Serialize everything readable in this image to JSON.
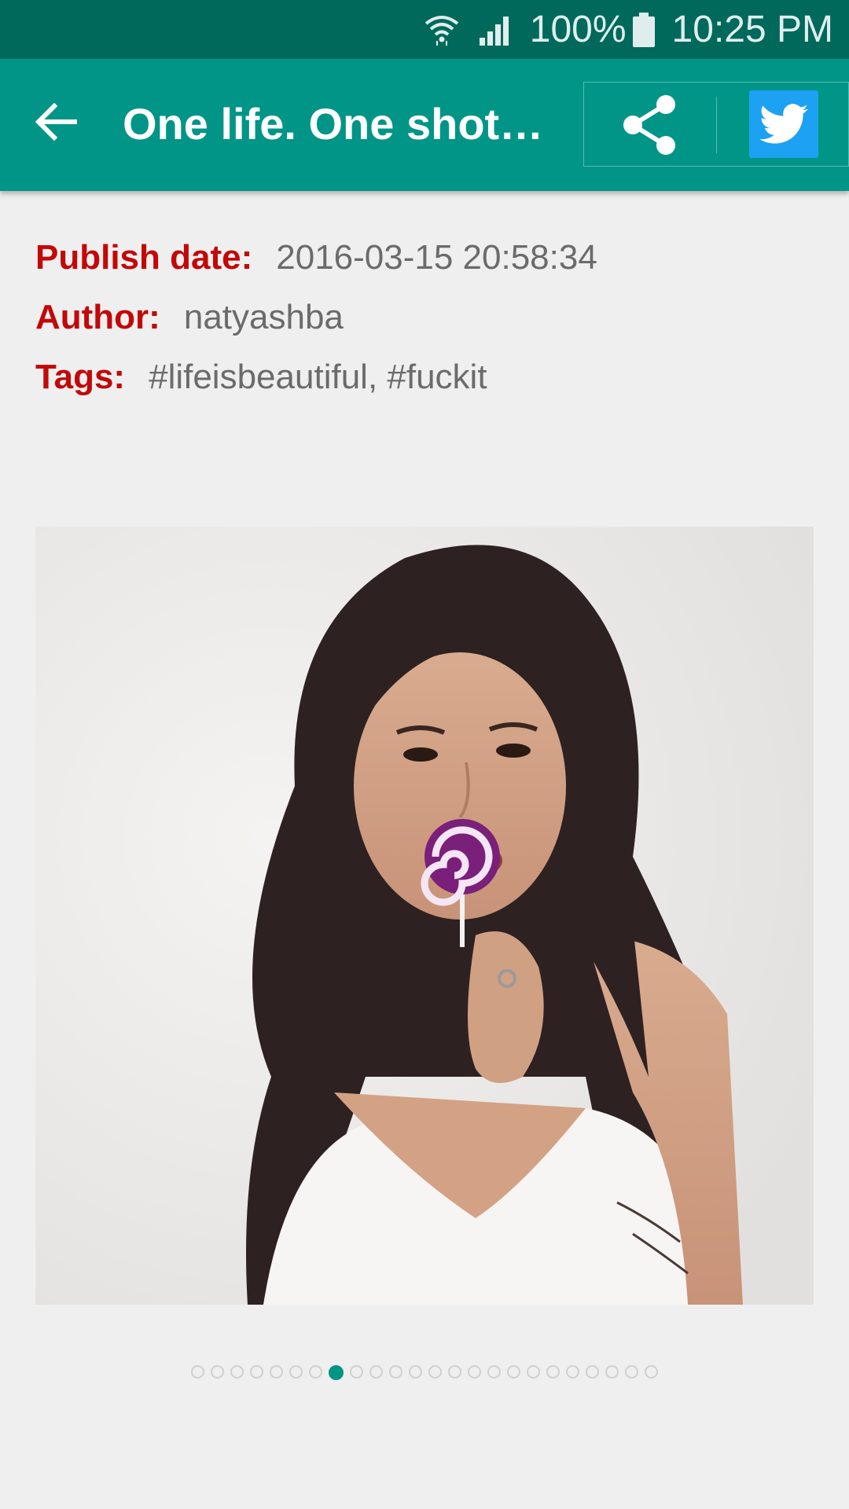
{
  "status_bar": {
    "battery": "100%",
    "time": "10:25 PM",
    "icons": [
      "wifi-icon",
      "signal-icon",
      "battery-icon"
    ],
    "color": "#00695c"
  },
  "app_bar": {
    "title": "One life. One shot. …",
    "color": "#009587",
    "actions": [
      "back-arrow-icon",
      "share-icon",
      "twitter-icon"
    ],
    "twitter_color": "#1da1f2"
  },
  "details": {
    "publish_label": "Publish date:",
    "publish_value": "2016-03-15 20:58:34",
    "author_label": "Author:",
    "author_value": "natyashba",
    "tags_label": "Tags:",
    "tags_value": "#lifeisbeautiful, #fuckit",
    "label_color": "#c20808"
  },
  "pager": {
    "total": 24,
    "current": 8
  }
}
